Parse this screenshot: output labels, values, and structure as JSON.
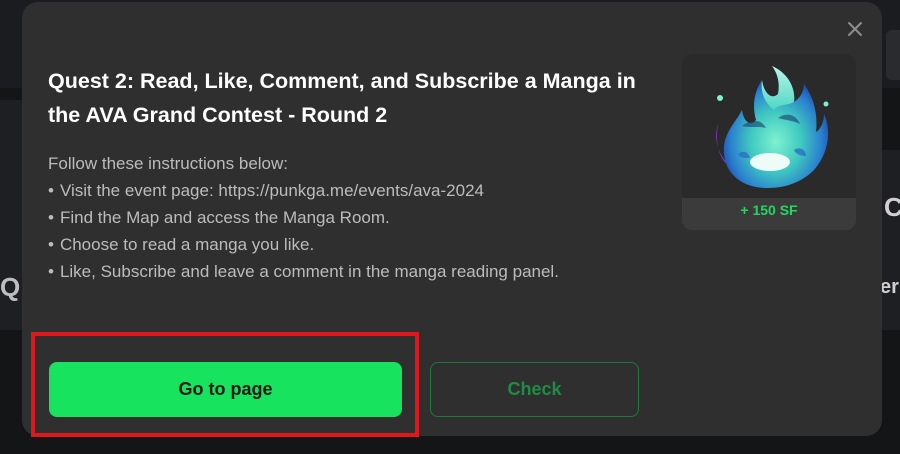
{
  "modal": {
    "title": "Quest 2: Read, Like, Comment, and Subscribe a Manga in the AVA Grand Contest - Round 2",
    "description": {
      "intro": "Follow these instructions below:",
      "steps": [
        "Visit the event page: https://punkga.me/events/ava-2024",
        "Find the Map and access the Manga Room.",
        "Choose to read a manga you like.",
        "Like, Subscribe and leave a comment in the manga reading panel."
      ]
    },
    "reward": {
      "label": "+ 150 SF",
      "image_icon": "blue-flame-icon"
    },
    "buttons": {
      "go_to_page": "Go to page",
      "check": "Check"
    },
    "close_icon": "close-icon"
  },
  "background": {
    "left_glyph": "Q",
    "right_glyph_1": "C",
    "right_glyph_2": "er"
  },
  "colors": {
    "modal_bg": "#2f2f30",
    "accent_green": "#17e35e",
    "reward_green": "#22d85f",
    "highlight_red": "#e0171d"
  }
}
